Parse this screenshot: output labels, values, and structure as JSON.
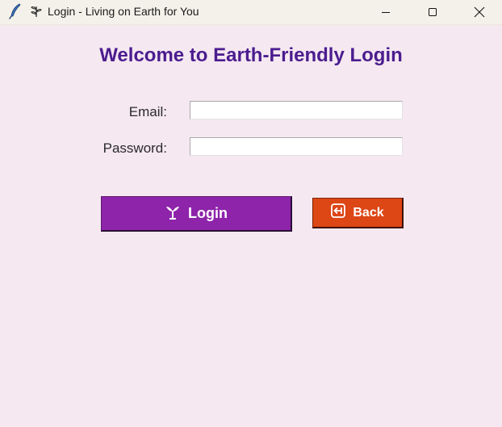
{
  "window": {
    "title": "Login - Living on Earth for You",
    "controls": [
      "minimize",
      "maximize",
      "close"
    ]
  },
  "header": {
    "title": "Welcome to Earth-Friendly Login"
  },
  "form": {
    "email_label": "Email:",
    "email_value": "",
    "password_label": "Password:",
    "password_value": ""
  },
  "actions": {
    "login_label": "Login",
    "login_icon": "plant-sprout-icon",
    "back_label": "Back",
    "back_icon": "back-arrow-icon"
  },
  "colors": {
    "background": "#f5e8f1",
    "heading": "#4b1c8f",
    "login_button": "#8e24aa",
    "back_button": "#dd4615"
  }
}
